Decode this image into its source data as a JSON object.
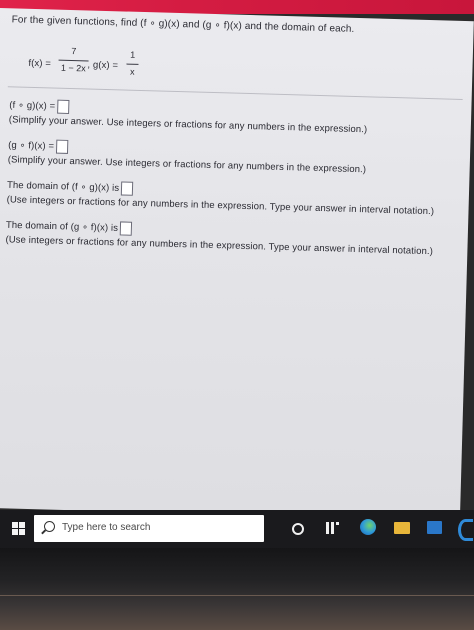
{
  "question": {
    "intro": "For the given functions, find (f ∘ g)(x) and (g ∘ f)(x) and the domain of each.",
    "f_label": "f(x) =",
    "f_numerator": "7",
    "f_denominator": "1 − 2x",
    "g_label": ", g(x) =",
    "g_numerator": "1",
    "g_denominator": "x",
    "parts": [
      {
        "label": "(f ∘ g)(x) =",
        "instruction": "(Simplify your answer. Use integers or fractions for any numbers in the expression.)"
      },
      {
        "label": "(g ∘ f)(x) =",
        "instruction": "(Simplify your answer. Use integers or fractions for any numbers in the expression.)"
      },
      {
        "label": "The domain of (f ∘ g)(x) is",
        "instruction": "(Use integers or fractions for any numbers in the expression. Type your answer in interval notation.)"
      },
      {
        "label": "The domain of (g ∘ f)(x) is",
        "instruction": "(Use integers or fractions for any numbers in the expression. Type your answer in interval notation.)"
      }
    ]
  },
  "taskbar": {
    "search_placeholder": "Type here to search",
    "icons": [
      "windows-start-icon",
      "search-icon",
      "cortana-icon",
      "task-view-icon",
      "edge-icon",
      "file-explorer-icon",
      "store-icon",
      "app-icon"
    ]
  }
}
